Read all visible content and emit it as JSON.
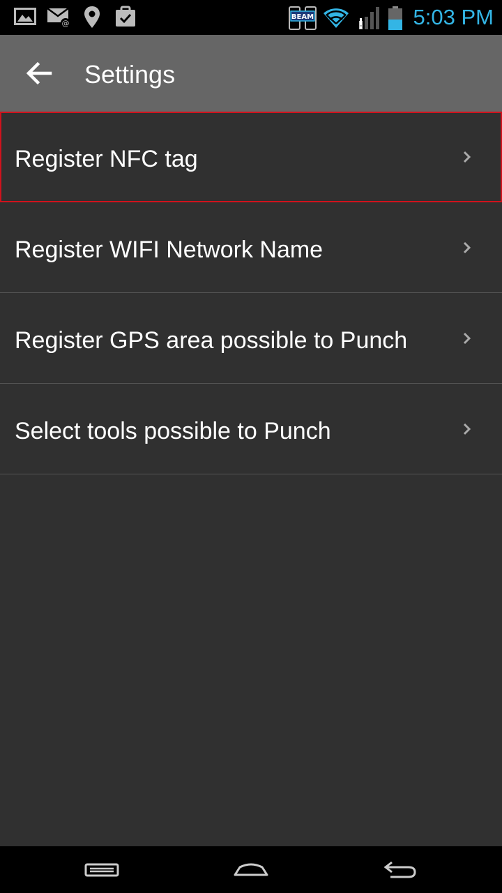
{
  "status_bar": {
    "time": "5:03 PM",
    "left_icons": [
      "image-icon",
      "email-icon",
      "location-pin-icon",
      "clipboard-check-icon"
    ],
    "right_icons": [
      "beam-icon",
      "wifi-icon",
      "signal-icon",
      "battery-icon"
    ],
    "beam_text": "BEAM",
    "accent_color": "#33b5e5"
  },
  "app_bar": {
    "title": "Settings",
    "back_icon": "back-arrow-icon",
    "background": "#666666"
  },
  "settings": {
    "items": [
      {
        "label": "Register NFC tag",
        "selected": true
      },
      {
        "label": "Register WIFI Network Name",
        "selected": false
      },
      {
        "label": "Register GPS area possible to Punch",
        "selected": false
      },
      {
        "label": "Select tools possible to Punch",
        "selected": false
      }
    ],
    "chevron_icon": "chevron-right-icon",
    "selection_color": "#d0121c"
  },
  "nav_bar": {
    "buttons": [
      "recent-apps-icon",
      "home-icon",
      "back-icon"
    ]
  }
}
